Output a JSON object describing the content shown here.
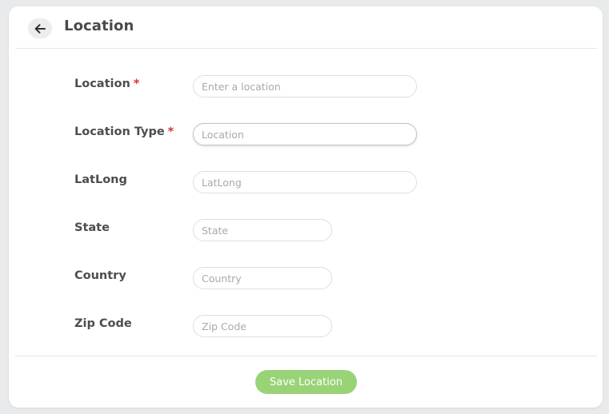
{
  "header": {
    "title": "Location",
    "back_icon": "arrow-left-icon"
  },
  "form": {
    "fields": [
      {
        "label": "Location",
        "required": true,
        "placeholder": "Enter a location",
        "value": ""
      },
      {
        "label": "Location Type",
        "required": true,
        "placeholder": "Location",
        "value": ""
      },
      {
        "label": "LatLong",
        "required": false,
        "placeholder": "LatLong",
        "value": ""
      },
      {
        "label": "State",
        "required": false,
        "placeholder": "State",
        "value": ""
      },
      {
        "label": "Country",
        "required": false,
        "placeholder": "Country",
        "value": ""
      },
      {
        "label": "Zip Code",
        "required": false,
        "placeholder": "Zip Code",
        "value": ""
      }
    ],
    "required_marker": "*"
  },
  "footer": {
    "save_label": "Save Location"
  },
  "colors": {
    "accent": "#99d378",
    "required": "#e0312d",
    "label": "#4d4d4d"
  }
}
